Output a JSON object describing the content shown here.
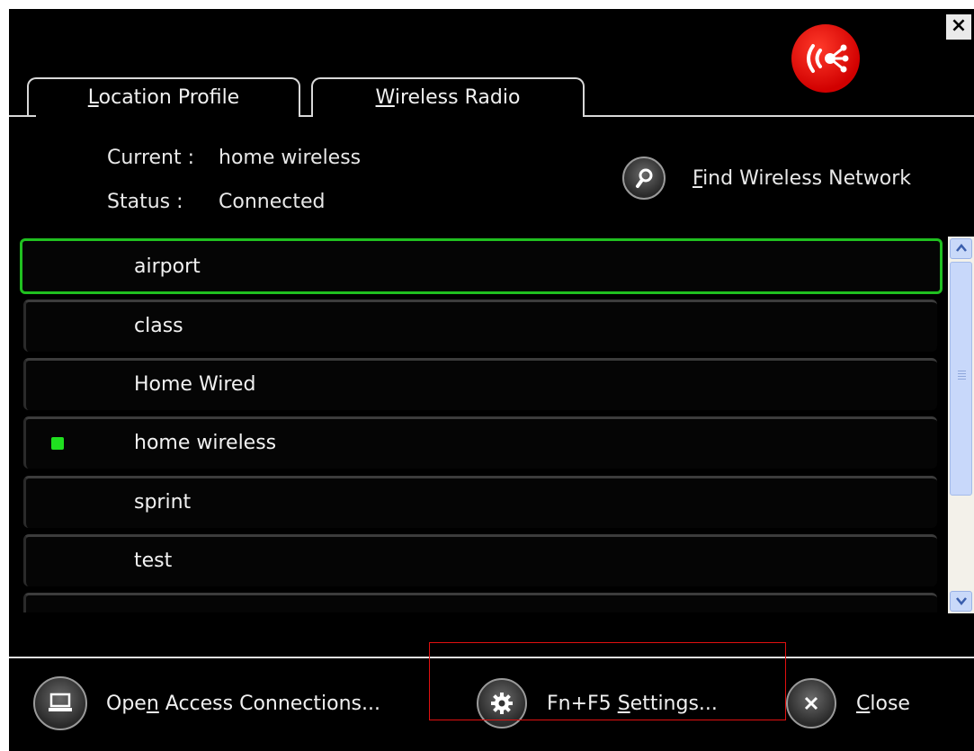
{
  "window": {
    "close_glyph": "×"
  },
  "header": {
    "logo_icon": "wireless-broadcast-icon"
  },
  "tabs": [
    {
      "label": "Location Profile",
      "mnemonic": "L",
      "rest": "ocation Profile",
      "active": true
    },
    {
      "label": "Wireless Radio",
      "mnemonic": "W",
      "rest": "ireless Radio",
      "active": false
    }
  ],
  "info": {
    "current_label": "Current :",
    "current_value": "home wireless",
    "status_label": "Status :",
    "status_value": "Connected"
  },
  "find_network": {
    "mnemonic": "F",
    "rest": "ind Wireless Network",
    "label": "Find Wireless Network",
    "icon": "magnifier-icon"
  },
  "profiles": [
    {
      "name": "airport",
      "selected": true,
      "connected": false
    },
    {
      "name": "class",
      "selected": false,
      "connected": false
    },
    {
      "name": "Home Wired",
      "selected": false,
      "connected": false
    },
    {
      "name": "home wireless",
      "selected": false,
      "connected": true
    },
    {
      "name": "sprint",
      "selected": false,
      "connected": false
    },
    {
      "name": "test",
      "selected": false,
      "connected": false
    }
  ],
  "footer": {
    "open_access": {
      "pre": "Ope",
      "mnemonic": "n",
      "post": " Access Connections...",
      "label": "Open Access Connections...",
      "icon": "laptop-icon"
    },
    "fn_settings": {
      "pre": "Fn+F5 ",
      "mnemonic": "S",
      "post": "ettings...",
      "label": "Fn+F5 Settings...",
      "icon": "gear-icon"
    },
    "close": {
      "pre": "",
      "mnemonic": "C",
      "post": "lose",
      "label": "Close",
      "icon": "close-circle-icon"
    }
  },
  "colors": {
    "accent_green": "#20c020",
    "logo_red": "#d10000",
    "highlight_red": "#e01010"
  }
}
